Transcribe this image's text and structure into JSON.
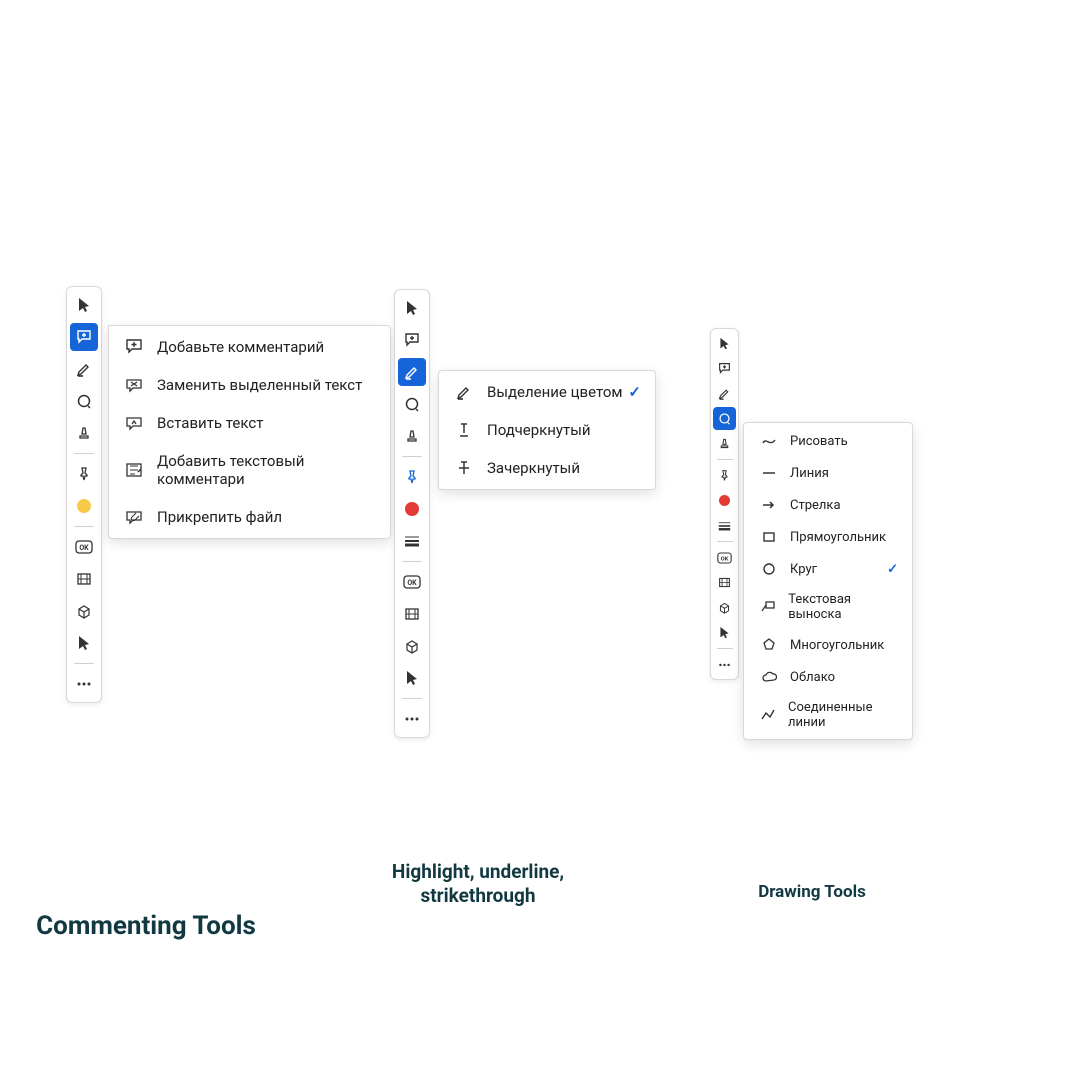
{
  "colors": {
    "accent": "#1565d8",
    "yellow": "#f7c948",
    "red": "#e53935",
    "caption": "#123942"
  },
  "panels": {
    "commenting": {
      "caption": "Commenting Tools",
      "flyout": [
        {
          "icon": "comment-plus-icon",
          "label": "Добавьте комментарий"
        },
        {
          "icon": "replace-text-icon",
          "label": "Заменить выделенный текст"
        },
        {
          "icon": "insert-text-icon",
          "label": "Вставить текст"
        },
        {
          "icon": "text-comment-icon",
          "label": "Добавить текстовый комментари"
        },
        {
          "icon": "attach-file-icon",
          "label": "Прикрепить файл"
        }
      ]
    },
    "highlight": {
      "caption": "Highlight, underline, strikethrough",
      "flyout": [
        {
          "icon": "highlighter-icon",
          "label": "Выделение цветом",
          "checked": true
        },
        {
          "icon": "underline-icon",
          "label": "Подчеркнутый"
        },
        {
          "icon": "strike-icon",
          "label": "Зачеркнутый"
        }
      ]
    },
    "drawing": {
      "caption": "Drawing Tools",
      "flyout": [
        {
          "icon": "freeform-icon",
          "label": "Рисовать"
        },
        {
          "icon": "line-icon",
          "label": "Линия"
        },
        {
          "icon": "arrow-icon",
          "label": "Стрелка"
        },
        {
          "icon": "rect-icon",
          "label": "Прямоугольник"
        },
        {
          "icon": "circle-icon",
          "label": "Круг",
          "checked": true
        },
        {
          "icon": "callout-icon",
          "label": "Текстовая выноска"
        },
        {
          "icon": "polygon-icon",
          "label": "Многоугольник"
        },
        {
          "icon": "cloud-icon",
          "label": "Облако"
        },
        {
          "icon": "polyline-icon",
          "label": "Соединенные линии"
        }
      ]
    }
  }
}
